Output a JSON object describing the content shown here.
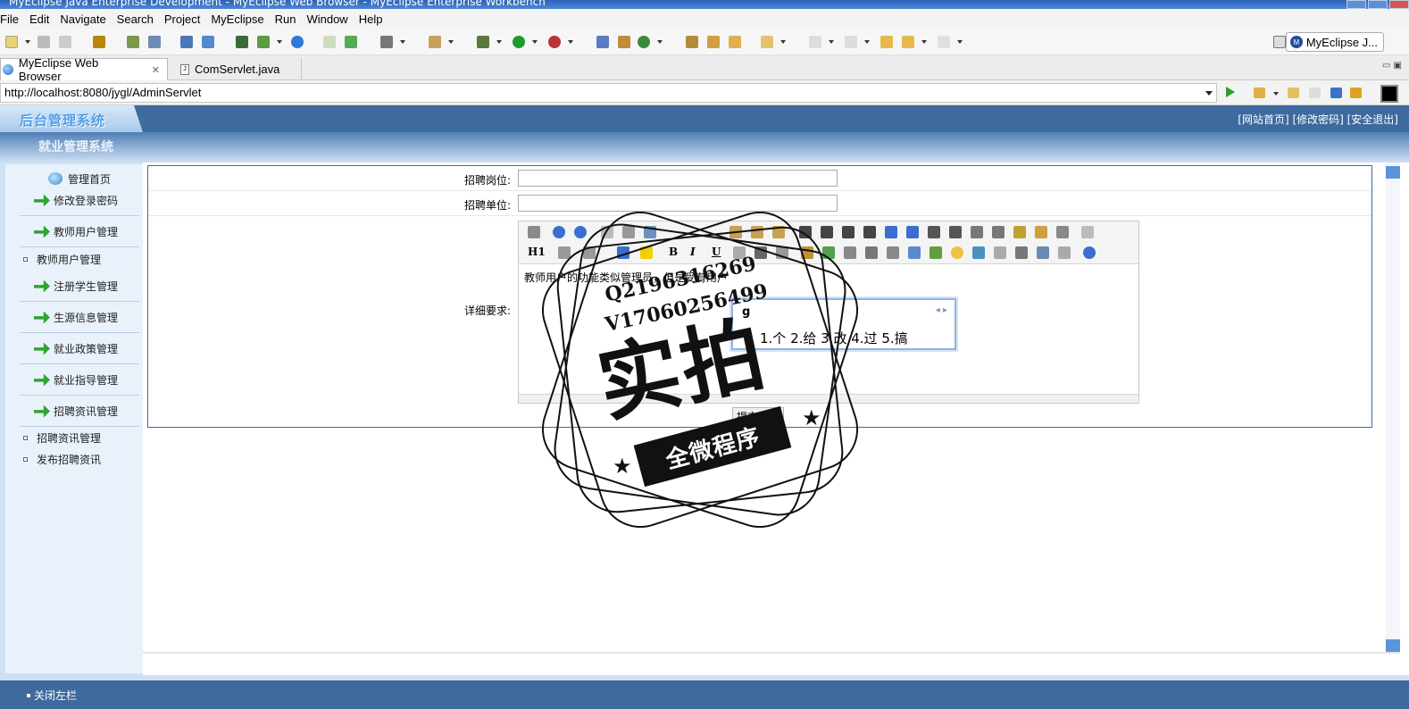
{
  "window": {
    "title": "MyEclipse Java Enterprise Development - MyEclipse Web Browser - MyEclipse Enterprise Workbench"
  },
  "menubar": [
    "File",
    "Edit",
    "Navigate",
    "Search",
    "Project",
    "MyEclipse",
    "Run",
    "Window",
    "Help"
  ],
  "toolbar": {
    "perspective_label": "MyEclipse J...",
    "perspective_icon_letter": "M"
  },
  "tabs": [
    {
      "label": "MyEclipse Web Browser",
      "close": "✕"
    },
    {
      "label": "ComServlet.java"
    }
  ],
  "browser": {
    "url": "http://localhost:8080/jygl/AdminServlet"
  },
  "page": {
    "logo_text": "后台管理系统",
    "top_links": "[网站首页] [修改密码] [安全退出]",
    "system_title": "就业管理系统",
    "footer_link": "关闭左栏"
  },
  "sidebar": {
    "home": "管理首页",
    "items": [
      {
        "label": "修改登录密码",
        "type": "group"
      },
      {
        "label": "教师用户管理",
        "type": "group"
      },
      {
        "label": "教师用户管理",
        "type": "sub"
      },
      {
        "label": "注册学生管理",
        "type": "group"
      },
      {
        "label": "生源信息管理",
        "type": "group"
      },
      {
        "label": "就业政策管理",
        "type": "group"
      },
      {
        "label": "就业指导管理",
        "type": "group"
      },
      {
        "label": "招聘资讯管理",
        "type": "group"
      },
      {
        "label": "招聘资讯管理",
        "type": "sub"
      },
      {
        "label": "发布招聘资讯",
        "type": "sub"
      }
    ]
  },
  "form": {
    "position_label": "招聘岗位:",
    "position_value": "",
    "company_label": "招聘单位:",
    "company_value": "",
    "detail_label": "详细要求:",
    "editor_text": "教师用户的功能类似管理员，但是受有用户",
    "editor_toolbar": {
      "h1": "H1",
      "bold": "B",
      "italic": "I",
      "underline": "U"
    },
    "ime": {
      "input": "g",
      "candidates": "1.个 2.给 3.改 4.过 5.搞",
      "nav": "◂ ▸"
    },
    "submit_label": "提交数据"
  },
  "watermark": {
    "line1": "Q2196316269",
    "line2": "V17060256499",
    "big": "实拍",
    "ribbon": "全微程序"
  },
  "colors": {
    "header_blue": "#3e6a9e",
    "sidebar_bg": "#e9f2fb",
    "go_green": "#2e9c2e"
  }
}
